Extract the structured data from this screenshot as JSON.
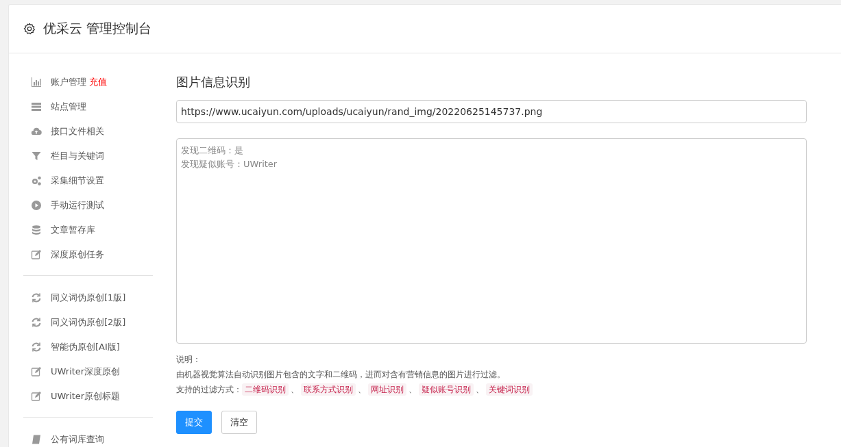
{
  "header": {
    "title": "优采云 管理控制台"
  },
  "sidebar": {
    "groups": [
      {
        "items": [
          {
            "label": "账户管理",
            "kind": "chart",
            "badge": "充值"
          },
          {
            "label": "站点管理",
            "kind": "server"
          },
          {
            "label": "接口文件相关",
            "kind": "cloud"
          },
          {
            "label": "栏目与关键词",
            "kind": "filter"
          },
          {
            "label": "采集细节设置",
            "kind": "gears"
          },
          {
            "label": "手动运行测试",
            "kind": "play"
          },
          {
            "label": "文章暂存库",
            "kind": "database"
          },
          {
            "label": "深度原创任务",
            "kind": "edit"
          }
        ]
      },
      {
        "items": [
          {
            "label": "同义词伪原创[1版]",
            "kind": "refresh"
          },
          {
            "label": "同义词伪原创[2版]",
            "kind": "refresh"
          },
          {
            "label": "智能伪原创[AI版]",
            "kind": "refresh"
          },
          {
            "label": "UWriter深度原创",
            "kind": "edit"
          },
          {
            "label": "UWriter原创标题",
            "kind": "edit"
          }
        ]
      },
      {
        "items": [
          {
            "label": "公有词库查询",
            "kind": "book"
          }
        ]
      }
    ]
  },
  "main": {
    "title": "图片信息识别",
    "url_field": {
      "value": "https://www.ucaiyun.com/uploads/ucaiyun/rand_img/20220625145737.png"
    },
    "result_box": {
      "lines": [
        "发现二维码：是",
        "发现疑似账号：UWriter"
      ]
    },
    "notes": {
      "heading": "说明：",
      "description": "由机器视觉算法自动识别图片包含的文字和二维码，进而对含有营销信息的图片进行过滤。",
      "filters_label": "支持的过滤方式：",
      "separator": "、",
      "tags": [
        "二维码识别",
        "联系方式识别",
        "网址识别",
        "疑似账号识别",
        "关键词识别"
      ]
    },
    "buttons": [
      {
        "label": "提交",
        "kind": "primary"
      },
      {
        "label": "清空",
        "kind": "default"
      }
    ]
  }
}
